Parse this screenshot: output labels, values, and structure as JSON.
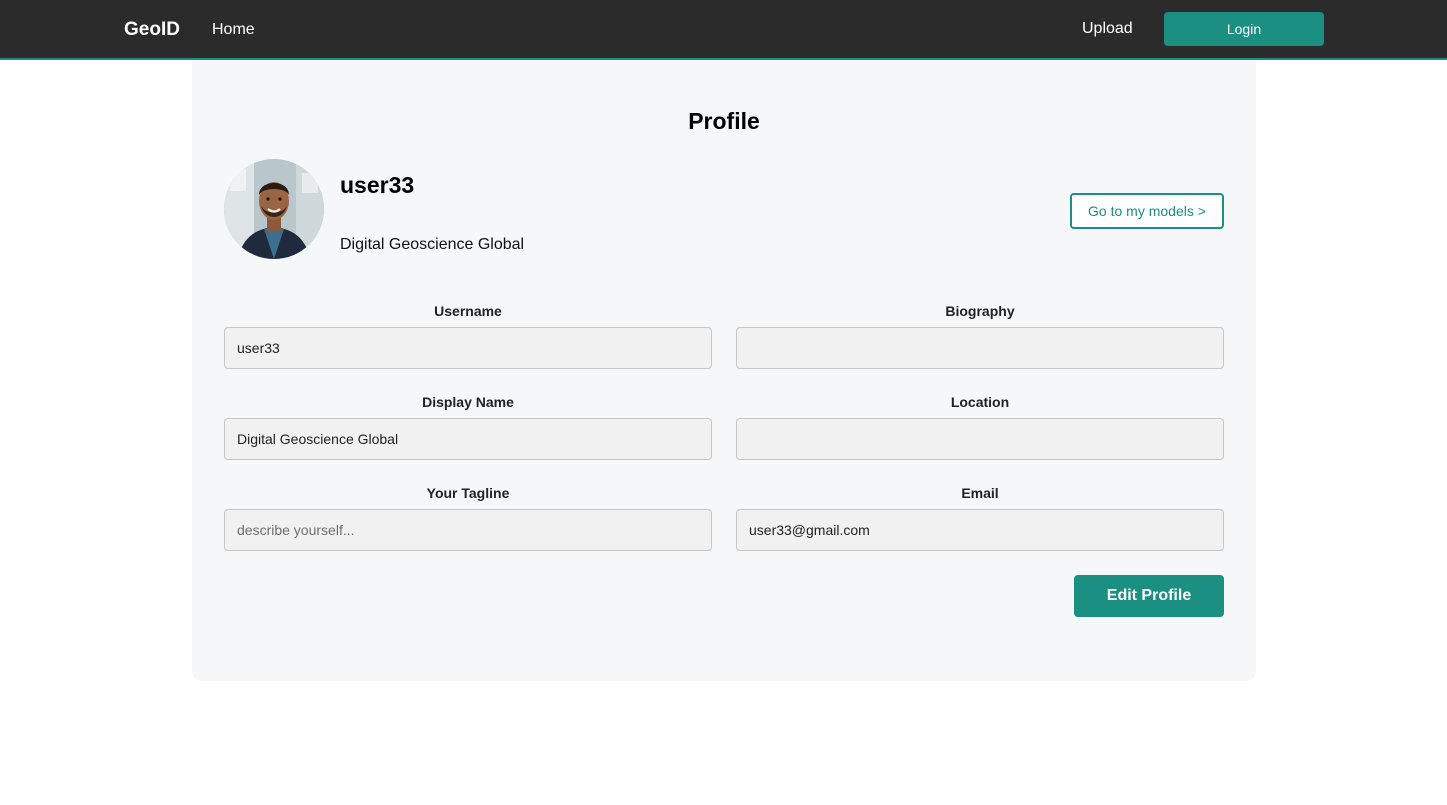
{
  "nav": {
    "brand": "GeoID",
    "home": "Home",
    "upload": "Upload",
    "login": "Login"
  },
  "profile": {
    "title": "Profile",
    "username": "user33",
    "display_name": "Digital Geoscience Global",
    "models_button": "Go to my models >"
  },
  "form": {
    "username": {
      "label": "Username",
      "value": "user33",
      "placeholder": ""
    },
    "biography": {
      "label": "Biography",
      "value": "",
      "placeholder": ""
    },
    "display_name": {
      "label": "Display Name",
      "value": "Digital Geoscience Global",
      "placeholder": ""
    },
    "location": {
      "label": "Location",
      "value": "",
      "placeholder": ""
    },
    "tagline": {
      "label": "Your Tagline",
      "value": "",
      "placeholder": "describe yourself..."
    },
    "email": {
      "label": "Email",
      "value": "user33@gmail.com",
      "placeholder": ""
    },
    "edit_button": "Edit Profile"
  },
  "colors": {
    "accent": "#1a8f82",
    "navbar": "#2b2b2b",
    "card": "#f6f7f9"
  }
}
